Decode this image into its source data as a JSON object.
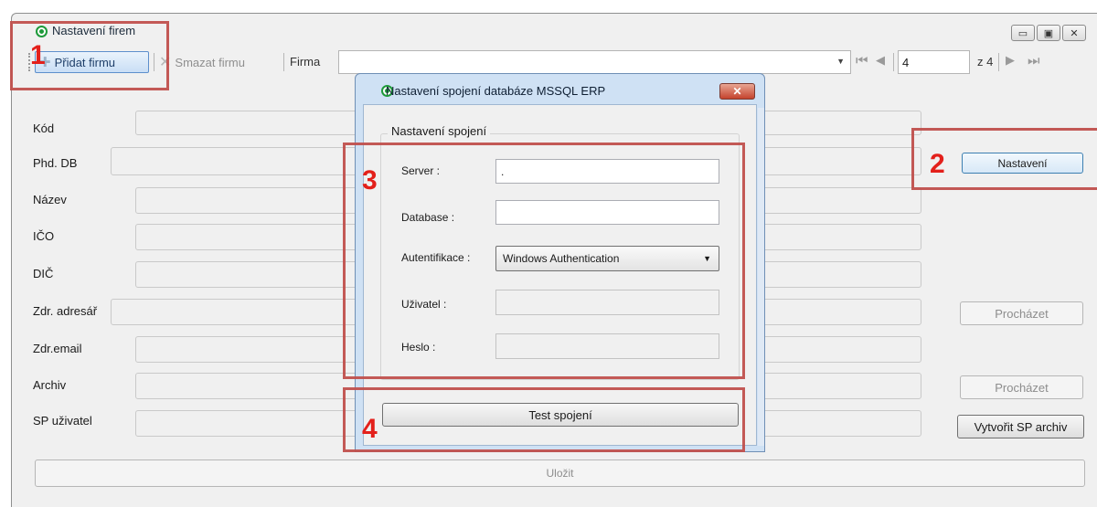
{
  "window": {
    "title": "Nastavení firem"
  },
  "toolbar": {
    "add_label": "Přidat firmu",
    "delete_label": "Smazat firmu",
    "firma_label": "Firma",
    "firma_value": "",
    "page_current": "4",
    "page_total": "z 4"
  },
  "form": {
    "rows": [
      {
        "label": "Kód"
      },
      {
        "label": "Phd. DB"
      },
      {
        "label": "Název"
      },
      {
        "label": "IČO"
      },
      {
        "label": "DIČ"
      },
      {
        "label": "Zdr. adresář"
      },
      {
        "label": "Zdr.email"
      },
      {
        "label": "Archiv"
      },
      {
        "label": "SP uživatel"
      }
    ],
    "nastaveni_label": "Nastavení",
    "prochazet1_label": "Procházet",
    "prochazet2_label": "Procházet",
    "vytvorit_label": "Vytvořit SP archiv",
    "ulozit_label": "Uložit"
  },
  "dialog": {
    "title": "Nastavení spojení databáze MSSQL ERP",
    "group_label": "Nastavení spojení",
    "server_label": "Server :",
    "server_value": ".",
    "database_label": "Database :",
    "database_value": "",
    "auth_label": "Autentifikace :",
    "auth_value": "Windows Authentication",
    "user_label": "Uživatel :",
    "user_value": "",
    "password_label": "Heslo :",
    "password_value": "",
    "test_label": "Test spojení"
  },
  "annotations": {
    "n1": "1",
    "n2": "2",
    "n3": "3",
    "n4": "4"
  },
  "colors": {
    "annotation": "#c0504d",
    "annotation_number": "#e3201b",
    "dialog_frame": "#cfe1f4"
  }
}
